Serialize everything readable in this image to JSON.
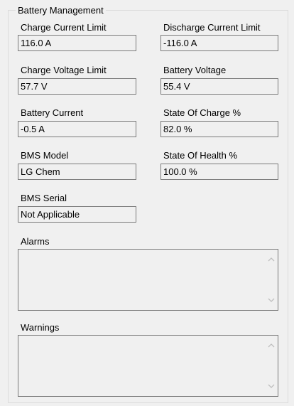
{
  "group": {
    "title": "Battery Management"
  },
  "fields": {
    "charge_current_limit": {
      "label": "Charge Current Limit",
      "value": "116.0 A"
    },
    "discharge_current_limit": {
      "label": "Discharge Current Limit",
      "value": "-116.0 A"
    },
    "charge_voltage_limit": {
      "label": "Charge Voltage Limit",
      "value": "57.7 V"
    },
    "battery_voltage": {
      "label": "Battery Voltage",
      "value": "55.4 V"
    },
    "battery_current": {
      "label": "Battery Current",
      "value": "-0.5 A"
    },
    "state_of_charge": {
      "label": "State Of Charge %",
      "value": "82.0 %"
    },
    "bms_model": {
      "label": "BMS Model",
      "value": "LG Chem"
    },
    "state_of_health": {
      "label": "State Of Health %",
      "value": "100.0 %"
    },
    "bms_serial": {
      "label": "BMS Serial",
      "value": "Not Applicable"
    }
  },
  "alarms": {
    "label": "Alarms",
    "value": ""
  },
  "warnings": {
    "label": "Warnings",
    "value": ""
  },
  "icons": {
    "scroll_up": "chevron-up-icon",
    "scroll_down": "chevron-down-icon"
  }
}
